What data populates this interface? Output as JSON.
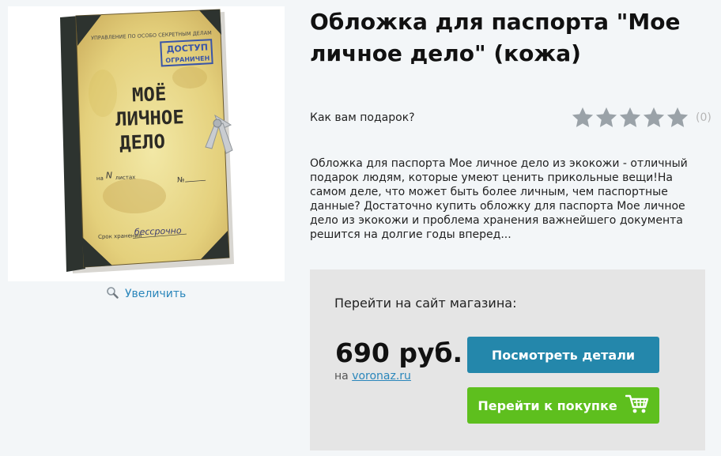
{
  "product": {
    "title": "Обложка для паспорта \"Мое личное дело\" (кожа)",
    "image_text": {
      "dept": "УПРАВЛЕНИЕ ПО ОСОБО СЕКРЕТНЫМ ДЕЛАМ",
      "stamp_line1": "ДОСТУП",
      "stamp_line2": "ОГРАНИЧЕН",
      "cover_line1": "МОЁ",
      "cover_line2": "ЛИЧНОЕ",
      "cover_line3": "ДЕЛО",
      "sheets_prefix": "на",
      "sheets_value": "N",
      "sheets_suffix": "листах",
      "number_sign": "№",
      "storage": "Срок хранения",
      "storage_value": "бессрочно"
    },
    "zoom_label": "Увеличить",
    "rating_question": "Как вам подарок?",
    "rating_value": 0,
    "rating_max": 5,
    "rating_count": "(0)",
    "description": "Обложка для паспорта Мое личное дело из экокожи - отличный подарок людям, которые умеют ценить прикольные вещи!На самом деле, что может быть более личным, чем паспортные данные? Достаточно купить обложку для паспорта Мое личное дело из экокожи и проблема хранения важнейшего документа решится на долгие годы вперед..."
  },
  "shop": {
    "goto_label": "Перейти на сайт магазина:",
    "price": "690 руб.",
    "on_prefix": "на",
    "store_link": "voronaz.ru",
    "details_button": "Посмотреть детали",
    "buy_button": "Перейти к покупке"
  },
  "colors": {
    "accent_link": "#2a86bb",
    "details_button_bg": "#2487ab",
    "buy_button_bg": "#5ebf1e",
    "star_gray": "#9aa2a8"
  },
  "icons": {
    "zoom": "magnifier-icon",
    "cart": "shopping-cart-icon",
    "star": "star-icon"
  }
}
